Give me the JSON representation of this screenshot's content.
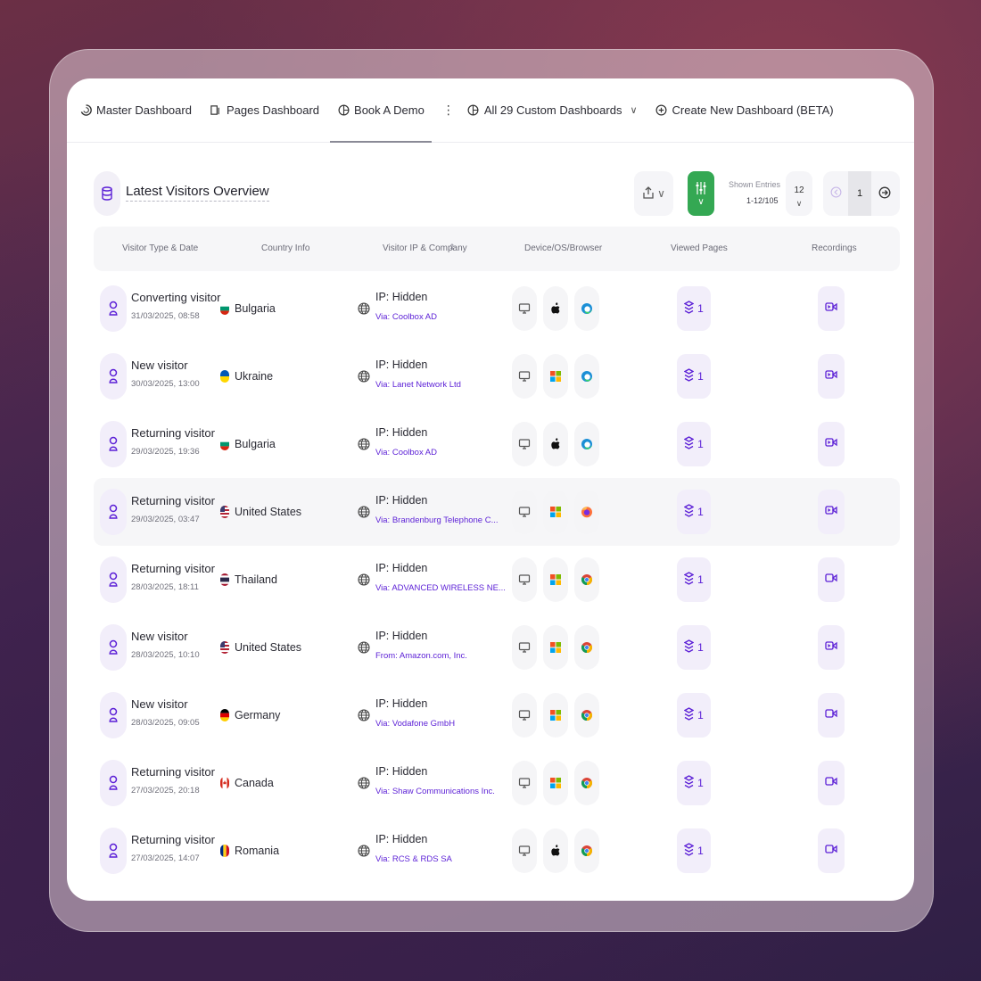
{
  "nav": {
    "items": [
      {
        "label": "Master Dashboard",
        "icon": "spinner-icon",
        "active": false
      },
      {
        "label": "Pages Dashboard",
        "icon": "page-icon",
        "active": false
      },
      {
        "label": "Book A Demo",
        "icon": "dashboard-globe-icon",
        "active": true
      }
    ],
    "custom_label": "All 29 Custom Dashboards",
    "create_label": "Create New Dashboard (BETA)"
  },
  "panel": {
    "title": "Latest Visitors Overview",
    "shown_entries_label": "Shown Entries",
    "shown_entries_value": "1-12/105",
    "per_page": "12",
    "current_page": "1"
  },
  "table": {
    "headers": [
      "Visitor Type & Date",
      "Country Info",
      "Visitor IP & Company",
      "Device/OS/Browser",
      "Viewed Pages",
      "Recordings"
    ],
    "rows": [
      {
        "type": "Converting visitor",
        "date": "31/03/2025, 08:58",
        "country": "Bulgaria",
        "flag": "bg",
        "ip": "IP: Hidden",
        "via": "Via: Coolbox AD",
        "os": "apple",
        "browser": "edge",
        "pages": "1",
        "rec": "active"
      },
      {
        "type": "New visitor",
        "date": "30/03/2025, 13:00",
        "country": "Ukraine",
        "flag": "ua",
        "ip": "IP: Hidden",
        "via": "Via: Lanet Network Ltd",
        "os": "windows",
        "browser": "edge",
        "pages": "1",
        "rec": "active"
      },
      {
        "type": "Returning visitor",
        "date": "29/03/2025, 19:36",
        "country": "Bulgaria",
        "flag": "bg",
        "ip": "IP: Hidden",
        "via": "Via: Coolbox AD",
        "os": "apple",
        "browser": "edge",
        "pages": "1",
        "rec": "active"
      },
      {
        "type": "Returning visitor",
        "date": "29/03/2025, 03:47",
        "country": "United States",
        "flag": "us",
        "ip": "IP: Hidden",
        "via": "Via: Brandenburg Telephone C...",
        "os": "windows",
        "browser": "firefox",
        "pages": "1",
        "rec": "active"
      },
      {
        "type": "Returning visitor",
        "date": "28/03/2025, 18:11",
        "country": "Thailand",
        "flag": "th",
        "ip": "IP: Hidden",
        "via": "Via: ADVANCED WIRELESS NE...",
        "os": "windows",
        "browser": "chrome",
        "pages": "1",
        "rec": "plain"
      },
      {
        "type": "New visitor",
        "date": "28/03/2025, 10:10",
        "country": "United States",
        "flag": "us",
        "ip": "IP: Hidden",
        "via": "From: Amazon.com, Inc.",
        "os": "windows",
        "browser": "chrome",
        "pages": "1",
        "rec": "active"
      },
      {
        "type": "New visitor",
        "date": "28/03/2025, 09:05",
        "country": "Germany",
        "flag": "de",
        "ip": "IP: Hidden",
        "via": "Via: Vodafone GmbH",
        "os": "windows",
        "browser": "chrome",
        "pages": "1",
        "rec": "plain"
      },
      {
        "type": "Returning visitor",
        "date": "27/03/2025, 20:18",
        "country": "Canada",
        "flag": "ca",
        "ip": "IP: Hidden",
        "via": "Via: Shaw Communications Inc.",
        "os": "windows",
        "browser": "chrome",
        "pages": "1",
        "rec": "plain"
      },
      {
        "type": "Returning visitor",
        "date": "27/03/2025, 14:07",
        "country": "Romania",
        "flag": "ro",
        "ip": "IP: Hidden",
        "via": "Via: RCS & RDS SA",
        "os": "apple",
        "browser": "chrome",
        "pages": "1",
        "rec": "plain"
      }
    ]
  },
  "colors": {
    "accent": "#5b1fd6",
    "filter_green": "#34a853",
    "row_highlight": "#f6f6f8"
  },
  "icons": [
    "spinner-icon",
    "page-icon",
    "dashboard-globe-icon",
    "more-icon",
    "plus-circle-icon",
    "database-icon",
    "share-icon",
    "filter-icon",
    "visitor-icon",
    "globe-icon",
    "desktop-icon",
    "apple-icon",
    "windows-icon",
    "edge-icon",
    "firefox-icon",
    "chrome-icon",
    "layers-icon",
    "video-icon"
  ]
}
